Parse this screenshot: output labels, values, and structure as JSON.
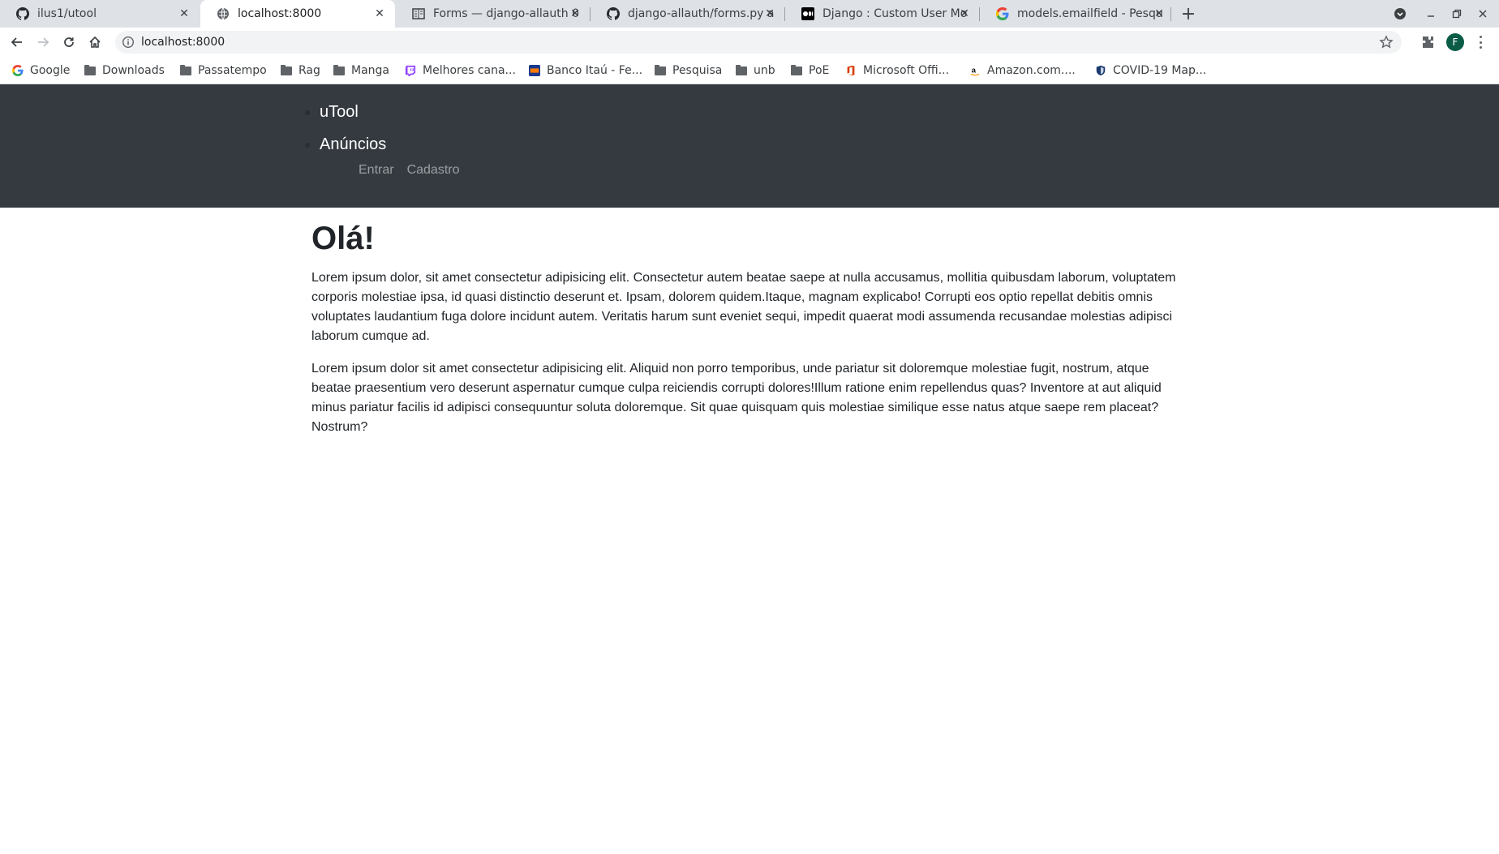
{
  "browser": {
    "tabs": [
      {
        "label": "ilus1/utool",
        "favicon": "github-icon",
        "active": false
      },
      {
        "label": "localhost:8000",
        "favicon": "globe-icon",
        "active": true
      },
      {
        "label": "Forms — django-allauth 0",
        "favicon": "document-icon",
        "active": false
      },
      {
        "label": "django-allauth/forms.py a",
        "favicon": "github-icon",
        "active": false
      },
      {
        "label": "Django : Custom User Mo",
        "favicon": "medium-icon",
        "active": false
      },
      {
        "label": "models.emailfield - Pesqu",
        "favicon": "google-icon",
        "active": false
      }
    ],
    "address_bar": {
      "url": "localhost:8000"
    },
    "profile_initial": "F",
    "bookmarks": [
      {
        "label": "Google",
        "icon": "google-icon"
      },
      {
        "label": "Downloads",
        "icon": "folder-icon"
      },
      {
        "label": "Passatempo",
        "icon": "folder-icon"
      },
      {
        "label": "Rag",
        "icon": "folder-icon"
      },
      {
        "label": "Manga",
        "icon": "folder-icon"
      },
      {
        "label": "Melhores cana...",
        "icon": "twitch-icon"
      },
      {
        "label": "Banco Itaú - Fe...",
        "icon": "itau-icon"
      },
      {
        "label": "Pesquisa",
        "icon": "folder-icon"
      },
      {
        "label": "unb",
        "icon": "folder-icon"
      },
      {
        "label": "PoE",
        "icon": "folder-icon"
      },
      {
        "label": "Microsoft Offi...",
        "icon": "office-icon"
      },
      {
        "label": "Amazon.com....",
        "icon": "amazon-icon"
      },
      {
        "label": "COVID-19 Map...",
        "icon": "shield-icon"
      }
    ]
  },
  "site": {
    "nav": {
      "brand": "uTool",
      "items": [
        "Anúncios"
      ],
      "auth": {
        "login": "Entrar",
        "signup": "Cadastro"
      }
    },
    "main": {
      "heading": "Olá!",
      "paragraphs": [
        "Lorem ipsum dolor, sit amet consectetur adipisicing elit. Consectetur autem beatae saepe at nulla accusamus, mollitia quibusdam laborum, voluptatem corporis molestiae ipsa, id quasi distinctio deserunt et. Ipsam, dolorem quidem.Itaque, magnam explicabo! Corrupti eos optio repellat debitis omnis voluptates laudantium fuga dolore incidunt autem. Veritatis harum sunt eveniet sequi, impedit quaerat modi assumenda recusandae molestias adipisci laborum cumque ad.",
        "Lorem ipsum dolor sit amet consectetur adipisicing elit. Aliquid non porro temporibus, unde pariatur sit doloremque molestiae fugit, nostrum, atque beatae praesentium vero deserunt aspernatur cumque culpa reiciendis corrupti dolores!Illum ratione enim repellendus quas? Inventore at aut aliquid minus pariatur facilis id adipisci consequuntur soluta doloremque. Sit quae quisquam quis molestiae similique esse natus atque saepe rem placeat? Nostrum?"
      ]
    }
  },
  "colors": {
    "navbar_bg": "#343a40",
    "text": "#212529",
    "chrome_bg": "#dee1e6"
  }
}
